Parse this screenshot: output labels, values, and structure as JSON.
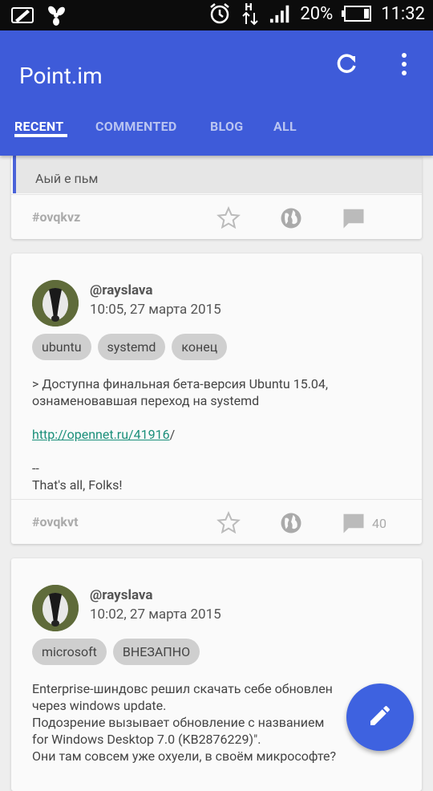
{
  "status": {
    "battery": "20%",
    "time": "11:32"
  },
  "app": {
    "title": "Point.im"
  },
  "tabs": [
    {
      "label": "RECENT"
    },
    {
      "label": "COMMENTED"
    },
    {
      "label": "BLOG"
    },
    {
      "label": "ALL"
    }
  ],
  "post1": {
    "quote": "Аый е пьм",
    "tag_id": "#ovqkvz"
  },
  "post2": {
    "user": "@rayslava",
    "date": "10:05, 27 марта 2015",
    "tags": [
      "ubuntu",
      "systemd",
      "конец"
    ],
    "text1": "> Доступна финальная бета-версия Ubuntu 15.04,\nознаменовавшая переход на systemd",
    "link": "http://opennet.ru/41916",
    "link_tail": "/",
    "text2": "--\nThat's all, Folks!",
    "tag_id": "#ovqkvt",
    "comments": "40"
  },
  "post3": {
    "user": "@rayslava",
    "date": "10:02, 27 марта 2015",
    "tags": [
      "microsoft",
      "ВНЕЗАПНО"
    ],
    "text": "Enterprise-шиндовс решил скачать себе обновлен\nчерез windows update.\nПодозрение вызывает обновление с названием\nfor Windows Desktop 7.0 (KB2876229)\".\nОни там совсем уже охуели, в своём микрософте?"
  }
}
